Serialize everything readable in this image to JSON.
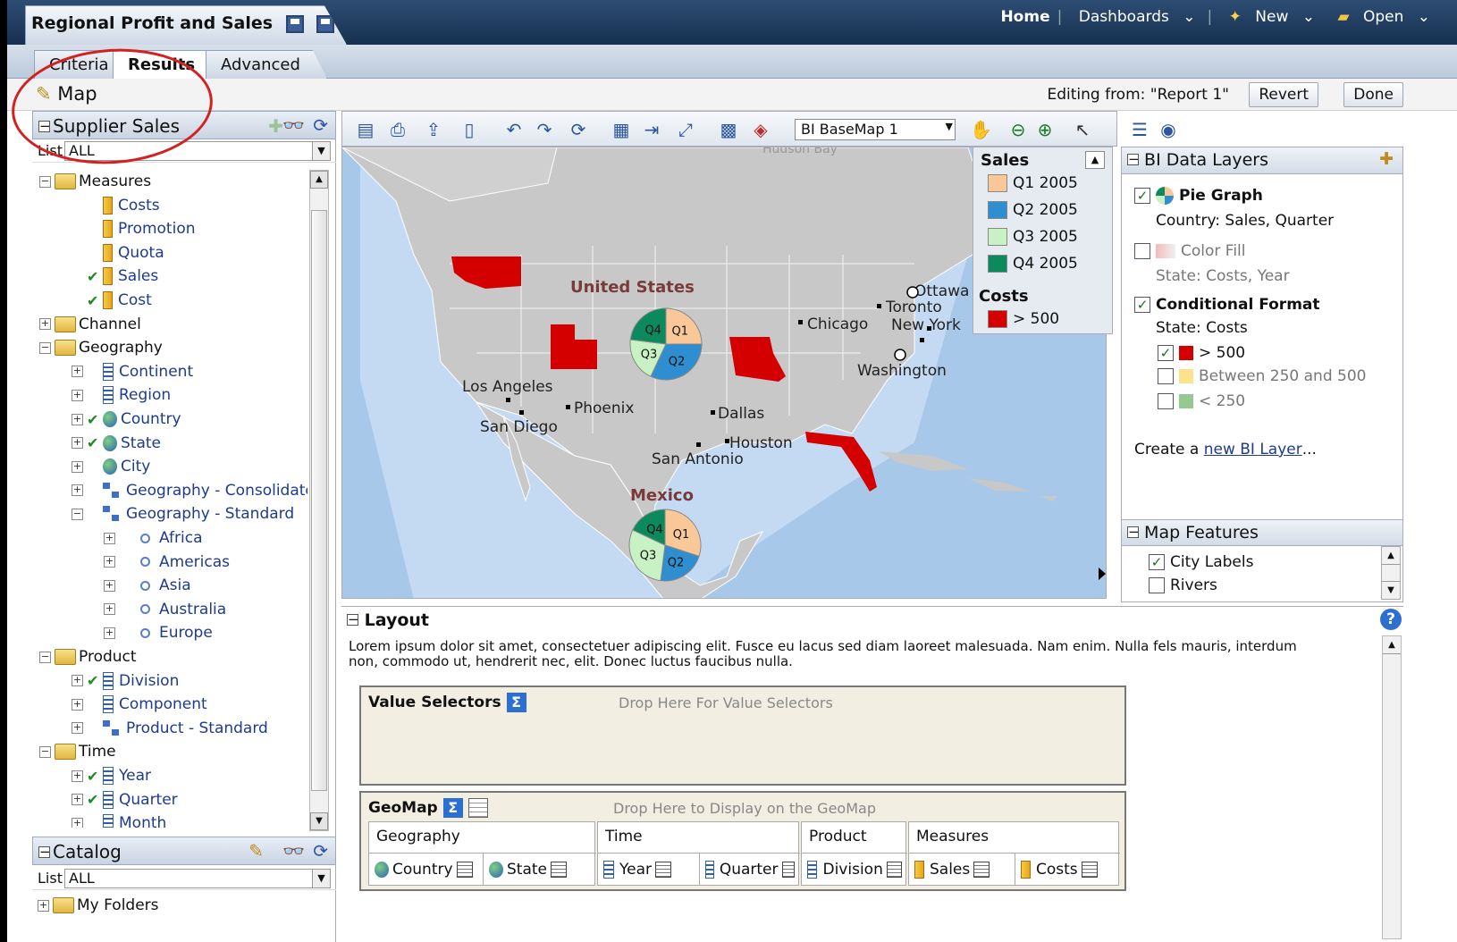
{
  "window": {
    "title": "Regional Profit and Sales"
  },
  "top_nav": {
    "home": "Home",
    "dashboards": "Dashboards",
    "new": "New",
    "open": "Open"
  },
  "tabs": [
    "Criteria",
    "Results",
    "Advanced"
  ],
  "view": {
    "title": "Map",
    "editing_label": "Editing from: \"Report 1\"",
    "revert": "Revert",
    "done": "Done"
  },
  "subject_area": {
    "title": "Supplier Sales",
    "list_label": "List",
    "list_value": "ALL",
    "tree": [
      {
        "label": "Measures",
        "type": "folder",
        "level": 0,
        "expanded": true
      },
      {
        "label": "Costs",
        "type": "measure",
        "level": 1
      },
      {
        "label": "Promotion",
        "type": "measure",
        "level": 1
      },
      {
        "label": "Quota",
        "type": "measure",
        "level": 1
      },
      {
        "label": "Sales",
        "type": "measure",
        "level": 1,
        "checked": true
      },
      {
        "label": "Cost",
        "type": "measure",
        "level": 1,
        "checked": true
      },
      {
        "label": "Channel",
        "type": "folder",
        "level": 0,
        "expanded": false
      },
      {
        "label": "Geography",
        "type": "folder",
        "level": 0,
        "expanded": true
      },
      {
        "label": "Continent",
        "type": "dim",
        "level": 1
      },
      {
        "label": "Region",
        "type": "dim",
        "level": 1
      },
      {
        "label": "Country",
        "type": "geo",
        "level": 1,
        "checked": true
      },
      {
        "label": "State",
        "type": "geo",
        "level": 1,
        "checked": true
      },
      {
        "label": "City",
        "type": "geo",
        "level": 1
      },
      {
        "label": "Geography - Consolidated",
        "type": "hier",
        "level": 1
      },
      {
        "label": "Geography - Standard",
        "type": "hier",
        "level": 1,
        "expanded": true
      },
      {
        "label": "Africa",
        "type": "lvl",
        "level": 2
      },
      {
        "label": "Americas",
        "type": "lvl",
        "level": 2
      },
      {
        "label": "Asia",
        "type": "lvl",
        "level": 2
      },
      {
        "label": "Australia",
        "type": "lvl",
        "level": 2
      },
      {
        "label": "Europe",
        "type": "lvl",
        "level": 2
      },
      {
        "label": "Product",
        "type": "folder",
        "level": 0,
        "expanded": true
      },
      {
        "label": "Division",
        "type": "dim",
        "level": 1,
        "checked": true
      },
      {
        "label": "Component",
        "type": "dim",
        "level": 1
      },
      {
        "label": "Product - Standard",
        "type": "hier",
        "level": 1
      },
      {
        "label": "Time",
        "type": "folder",
        "level": 0,
        "expanded": true
      },
      {
        "label": "Year",
        "type": "dim",
        "level": 1,
        "checked": true
      },
      {
        "label": "Quarter",
        "type": "dim",
        "level": 1,
        "checked": true
      },
      {
        "label": "Month",
        "type": "dim",
        "level": 1
      }
    ]
  },
  "catalog": {
    "title": "Catalog",
    "list_label": "List",
    "list_value": "ALL",
    "first_item": "My Folders"
  },
  "map_toolbar": {
    "basemap": "BI BaseMap 1"
  },
  "map": {
    "labels": {
      "united_states": "United States",
      "mexico": "Mexico"
    },
    "cities": [
      "Ottawa",
      "Toronto",
      "Chicago",
      "New York",
      "Washington",
      "Los Angeles",
      "Phoenix",
      "San Diego",
      "Dallas",
      "Houston",
      "San Antonio"
    ],
    "pie_labels": [
      "Q1",
      "Q2",
      "Q3",
      "Q4"
    ],
    "top_text": "Hudson Bay"
  },
  "legend": {
    "sales_title": "Sales",
    "sales_items": [
      {
        "label": "Q1 2005",
        "color": "#fac898"
      },
      {
        "label": "Q2 2005",
        "color": "#2e8ecf"
      },
      {
        "label": "Q3 2005",
        "color": "#c9f2c4"
      },
      {
        "label": "Q4 2005",
        "color": "#0c8a5e"
      }
    ],
    "costs_title": "Costs",
    "costs_items": [
      {
        "label": "> 500",
        "color": "#d40000"
      }
    ]
  },
  "data_layers": {
    "title": "BI Data Layers",
    "pie": {
      "label": "Pie Graph",
      "desc": "Country: Sales, Quarter"
    },
    "fill": {
      "label": "Color Fill",
      "desc": "State: Costs, Year"
    },
    "cond": {
      "label": "Conditional Format",
      "desc": "State: Costs"
    },
    "conditions": [
      {
        "label": "> 500",
        "color": "#d40000",
        "checked": true
      },
      {
        "label": "Between 250 and 500",
        "color": "#fbe38a",
        "checked": false
      },
      {
        "label": "< 250",
        "color": "#94c98f",
        "checked": false
      }
    ],
    "create_prefix": "Create a ",
    "create_link": "new BI Layer",
    "create_suffix": "..."
  },
  "map_features": {
    "title": "Map Features",
    "city_labels": "City Labels",
    "rivers": "Rivers"
  },
  "layout": {
    "title": "Layout",
    "description": "Lorem ipsum dolor sit amet, consectetuer adipiscing elit. Fusce eu lacus sed diam laoreet malesuada. Nam enim. Nulla fels mauris, interdum non, commodo ut, hendrerit nec, elit. Donec luctus faucibus nulla.",
    "value_selectors": "Value Selectors",
    "value_hint": "Drop Here For Value Selectors",
    "geomap": "GeoMap",
    "geomap_hint": "Drop Here to Display on the GeoMap",
    "groups": [
      {
        "name": "Geography",
        "items": [
          "Country",
          "State"
        ]
      },
      {
        "name": "Time",
        "items": [
          "Year",
          "Quarter"
        ]
      },
      {
        "name": "Product",
        "items": [
          "Division"
        ]
      },
      {
        "name": "Measures",
        "items": [
          "Sales",
          "Costs"
        ]
      }
    ]
  }
}
